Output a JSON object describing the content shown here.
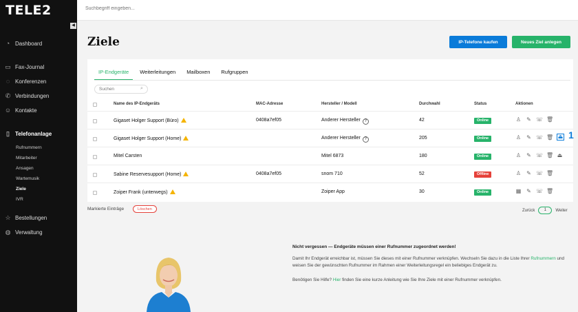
{
  "brand": {
    "logo": "TELE2"
  },
  "topbar": {
    "search_placeholder": "Suchbegriff eingeben..."
  },
  "sidebar": {
    "collapse_glyph": "◀",
    "items": [
      {
        "label": "Dashboard",
        "icon": "speedometer-icon"
      },
      {
        "label": "Fax-Journal",
        "icon": "fax-icon"
      },
      {
        "label": "Konferenzen",
        "icon": "conference-icon"
      },
      {
        "label": "Verbindungen",
        "icon": "phone-icon"
      },
      {
        "label": "Kontakte",
        "icon": "contacts-icon"
      },
      {
        "label": "Telefonanlage",
        "icon": "pbx-icon"
      },
      {
        "label": "Bestellungen",
        "icon": "cart-icon"
      },
      {
        "label": "Verwaltung",
        "icon": "admin-icon"
      }
    ],
    "subitems": [
      "Rufnummern",
      "Mitarbeiter",
      "Ansagen",
      "Wartemusik",
      "Ziele",
      "IVR"
    ]
  },
  "page": {
    "title": "Ziele",
    "buy_button": "IP-Telefone kaufen",
    "new_button": "Neues Ziel anlegen"
  },
  "tabs": [
    "IP-Endgeräte",
    "Weiterleitungen",
    "Mailboxen",
    "Rufgruppen"
  ],
  "table": {
    "search_placeholder": "Suchen",
    "headers": [
      "Name des IP-Endgeräts",
      "MAC-Adresse",
      "Hersteller / Modell",
      "Durchwahl",
      "Status",
      "Aktionen"
    ],
    "rows": [
      {
        "name": "Gigaset Holger Support (Büro)",
        "warn": true,
        "mac": "0408a7ef05",
        "vendor": "Anderer Hersteller",
        "help": true,
        "ext": "42",
        "status": "Online"
      },
      {
        "name": "Gigaset Holger Support (Home)",
        "warn": true,
        "mac": "",
        "vendor": "Anderer Hersteller",
        "help": true,
        "ext": "205",
        "status": "Online"
      },
      {
        "name": "Mitel Carsten",
        "warn": false,
        "mac": "",
        "vendor": "Mitel 6873",
        "help": false,
        "ext": "180",
        "status": "Online"
      },
      {
        "name": "Sabine Reservesupport (Home)",
        "warn": true,
        "mac": "0408a7ef05",
        "vendor": "snom 710",
        "help": false,
        "ext": "52",
        "status": "Offline"
      },
      {
        "name": "Zoiper Frank (unterwegs)",
        "warn": true,
        "mac": "",
        "vendor": "Zoiper App",
        "help": false,
        "ext": "30",
        "status": "Online"
      }
    ]
  },
  "annotation": "1",
  "footer": {
    "marked_label": "Markierte Einträge",
    "delete_button": "Löschen",
    "prev": "Zurück",
    "page": "1",
    "next": "Weiter"
  },
  "hint": {
    "title": "Nicht vergessen — Endgeräte müssen einer Rufnummer zugeordnet werden!",
    "p1_a": "Damit Ihr Endgerät erreichbar ist, müssen Sie dieses mit einer Rufnummer verknüpfen. Wechseln Sie dazu in die Liste Ihrer",
    "p1_link": "Rufnummern",
    "p1_b": "und weisen Sie der gewünschten Rufnummer im Rahmen einer Weiterleitungsregel ein beliebiges Endgerät zu.",
    "p2_a": "Benötigen Sie Hilfe?",
    "p2_link": "Hier",
    "p2_b": "finden Sie eine kurze Anleitung wie Sie Ihre Ziele mit einer Rufnummer verknüpfen."
  },
  "colors": {
    "accent_green": "#27b36a",
    "accent_blue": "#0a7bd9",
    "offline_red": "#e5413a",
    "sidebar_bg": "#111111"
  }
}
